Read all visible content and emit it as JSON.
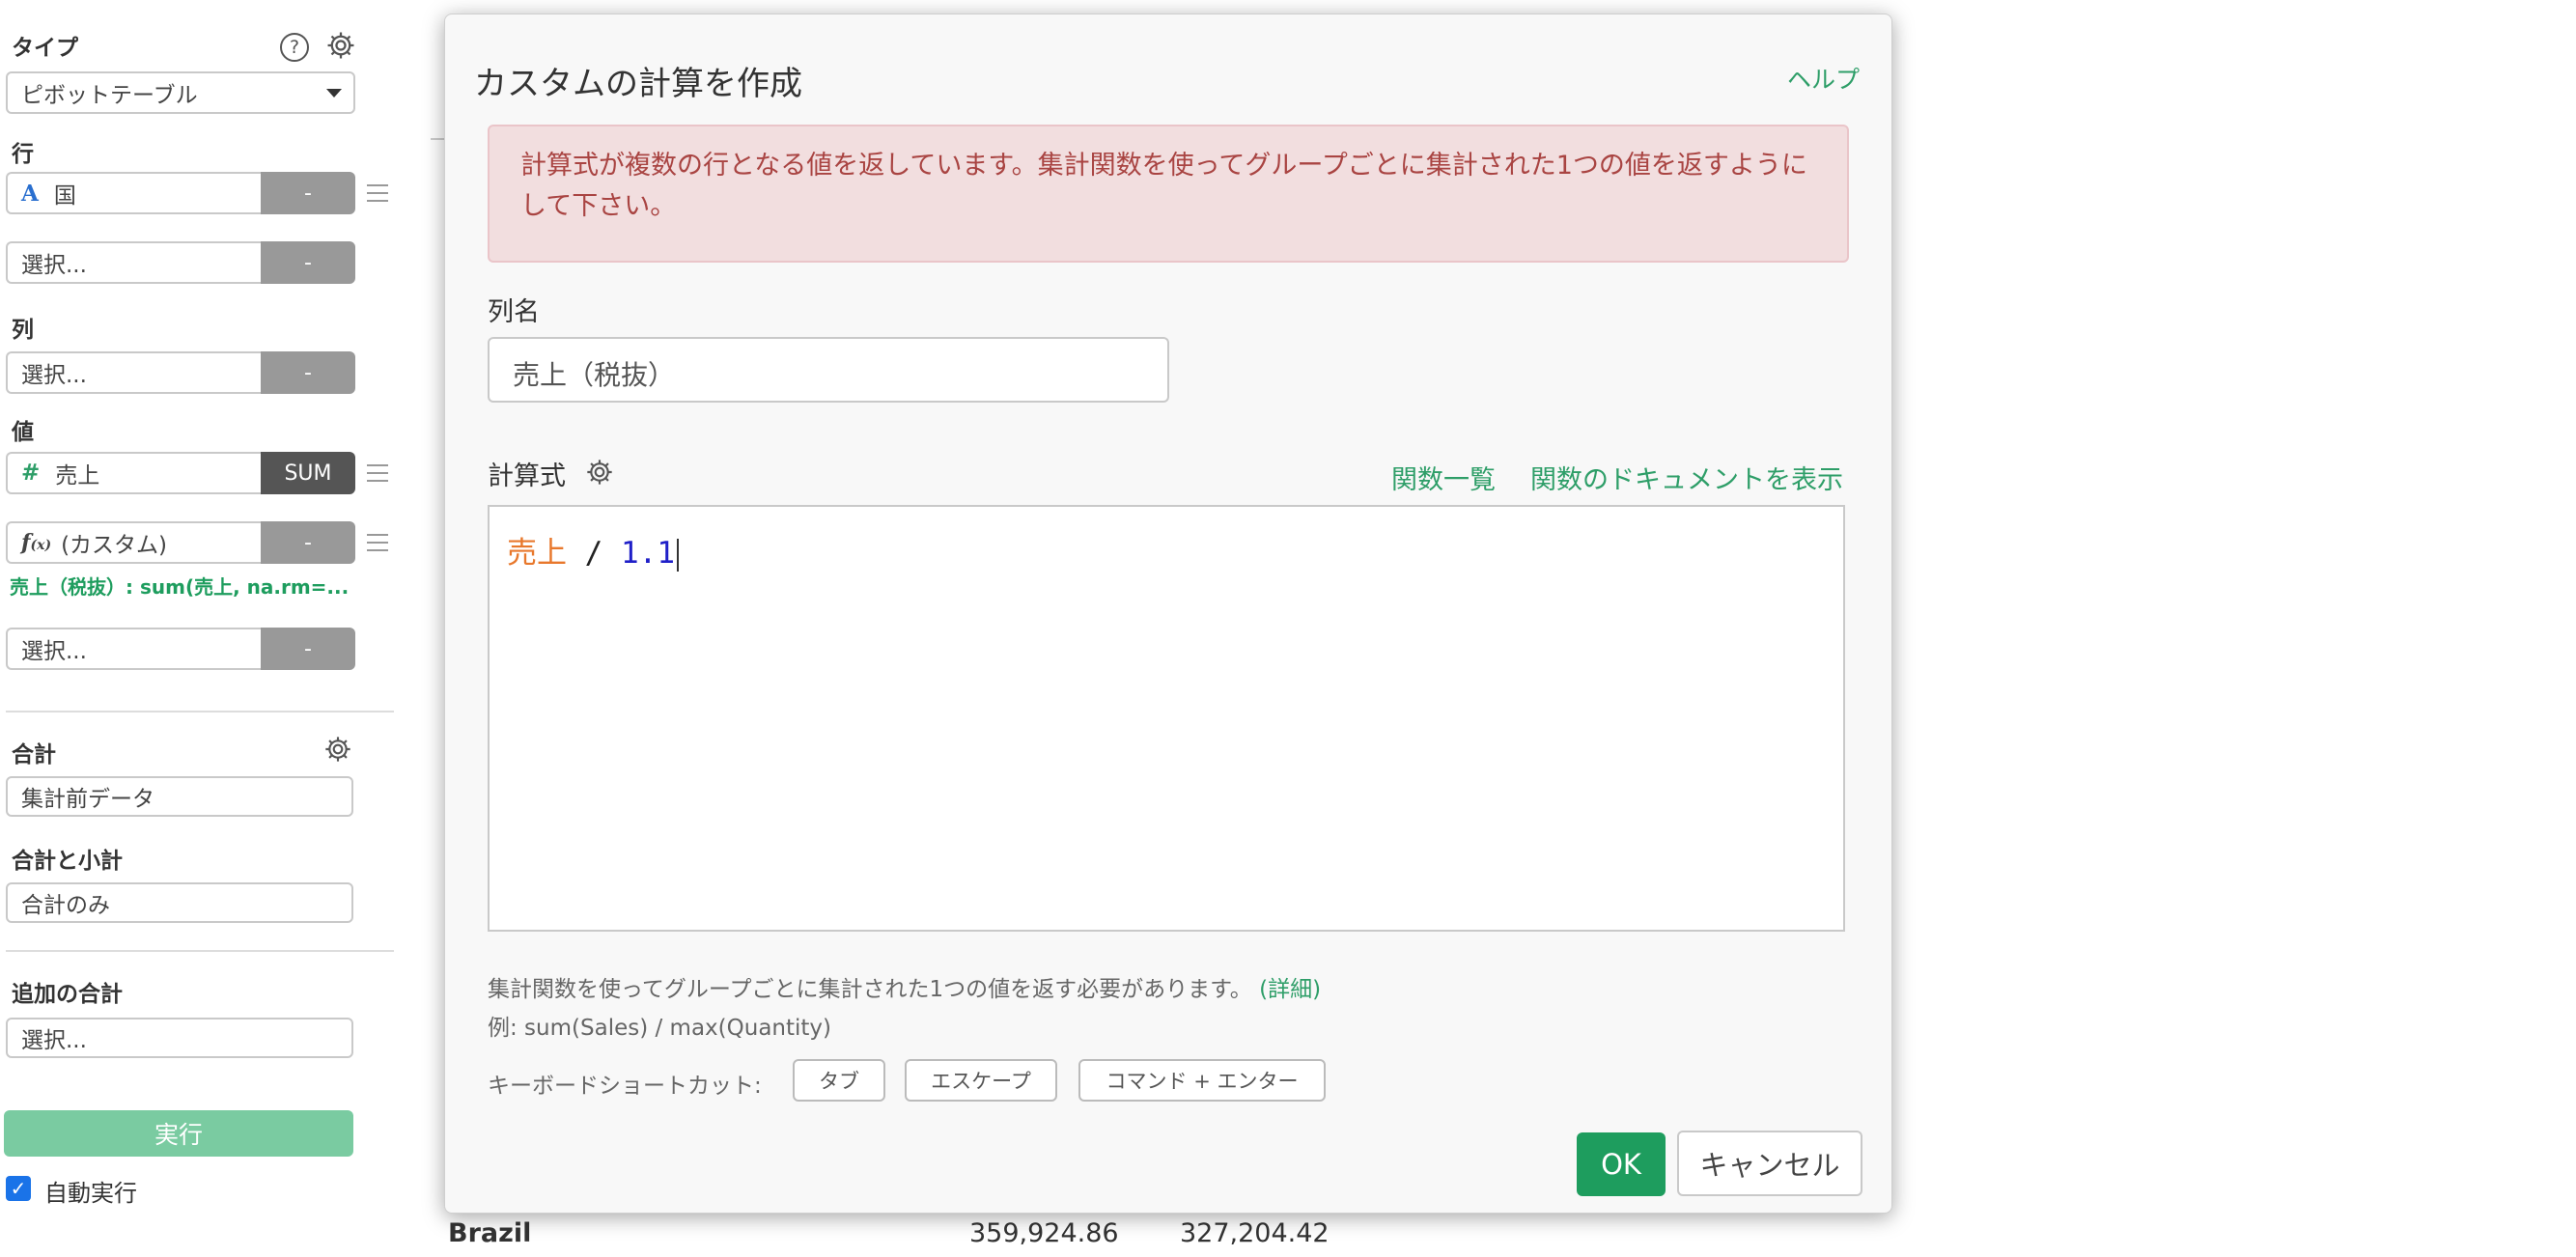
{
  "sidebar": {
    "type_label": "タイプ",
    "type_value": "ピボットテーブル",
    "row_label": "行",
    "row_field_1": "国",
    "row_field_2": "選択...",
    "column_label": "列",
    "column_field": "選択...",
    "value_label": "値",
    "value_field_1": "売上",
    "value_agg_1": "SUM",
    "value_field_2": "(カスタム)",
    "custom_summary": "売上（税抜）: sum(売上, na.rm=...",
    "value_field_3": "選択...",
    "dash": "-",
    "total_label": "合計",
    "total_value": "集計前データ",
    "subtotal_label": "合計と小計",
    "subtotal_value": "合計のみ",
    "additional_total_label": "追加の合計",
    "additional_total_value": "選択...",
    "run_button": "実行",
    "auto_run_label": "自動実行",
    "auto_run_checked": true
  },
  "background_table": {
    "row_label": "Brazil",
    "value_1": "359,924.86",
    "value_2": "327,204.42"
  },
  "dialog": {
    "title": "カスタムの計算を作成",
    "help_link": "ヘルプ",
    "error_message": "計算式が複数の行となる値を返しています。集計関数を使ってグループごとに集計された1つの値を返すようにして下さい。",
    "column_name_label": "列名",
    "column_name_value": "売上（税抜）",
    "formula_label": "計算式",
    "function_list_link": "関数一覧",
    "function_docs_link": "関数のドキュメントを表示",
    "formula": {
      "column_token": "売上",
      "operator_token": " / ",
      "number_token": "1.1"
    },
    "hint_text": "集計関数を使ってグループごとに集計された1つの値を返す必要があります。",
    "hint_link": "(詳細)",
    "example_text": "例: sum(Sales) / max(Quantity)",
    "shortcut_label": "キーボードショートカット:",
    "shortcut_keys": [
      "タブ",
      "エスケープ",
      "コマンド + エンター"
    ],
    "ok_button": "OK",
    "cancel_button": "キャンセル"
  },
  "colors": {
    "accent_green": "#1e9d5e",
    "link_green": "#2e9e68",
    "error_text": "#a94442",
    "error_bg": "#f2dedf",
    "token_column": "#e8782c",
    "token_number": "#1f1fc8"
  }
}
